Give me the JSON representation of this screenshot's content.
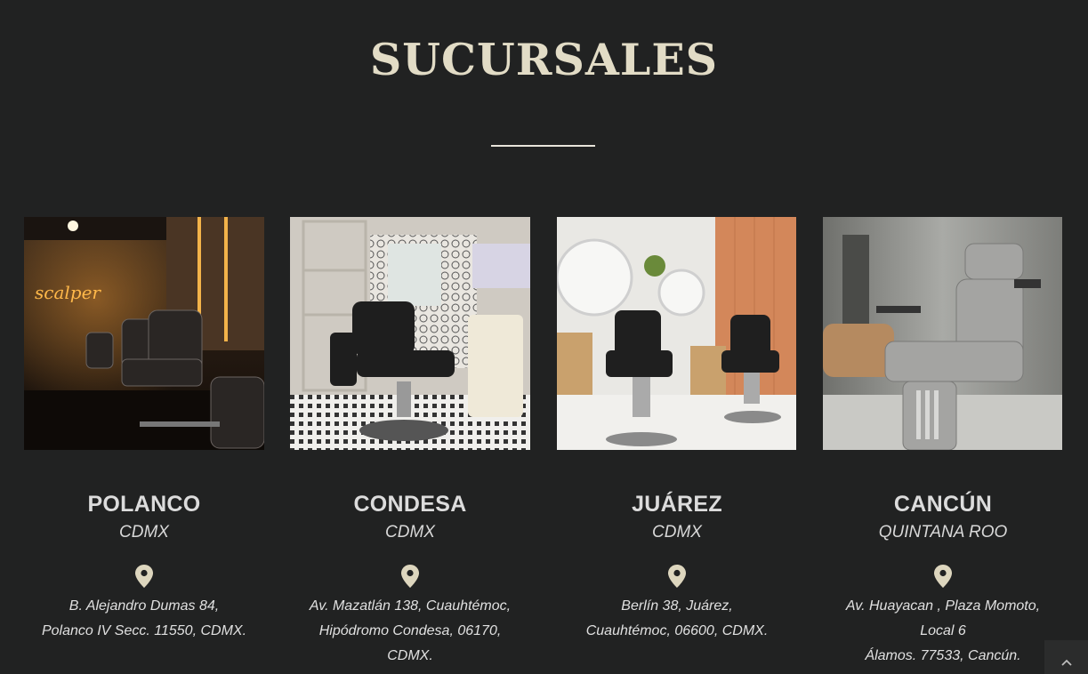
{
  "section": {
    "title": "SUCURSALES"
  },
  "branches": [
    {
      "name": "POLANCO",
      "region": "CDMX",
      "address_lines": [
        "B. Alejandro Dumas 84,",
        "Polanco IV Secc. 11550, CDMX."
      ],
      "photo": "barbershop-interior-photo"
    },
    {
      "name": "CONDESA",
      "region": "CDMX",
      "address_lines": [
        "Av. Mazatlán 138, Cuauhtémoc,",
        "Hipódromo Condesa, 06170,",
        "CDMX."
      ],
      "photo": "barbershop-interior-photo"
    },
    {
      "name": "JUÁREZ",
      "region": "CDMX",
      "address_lines": [
        "Berlín 38, Juárez,",
        "Cuauhtémoc, 06600, CDMX."
      ],
      "photo": "barbershop-interior-photo"
    },
    {
      "name": "CANCÚN",
      "region": "QUINTANA ROO",
      "address_lines": [
        "Av. Huayacan , Plaza Momoto,",
        "Local 6",
        "Álamos. 77533, Cancún."
      ],
      "photo": "barbershop-interior-photo"
    }
  ],
  "icons": {
    "location": "map-pin-icon",
    "scroll_top": "chevron-up-icon"
  },
  "colors": {
    "background": "#212222",
    "title": "#e2dcc6",
    "pin": "#ddd6be"
  }
}
